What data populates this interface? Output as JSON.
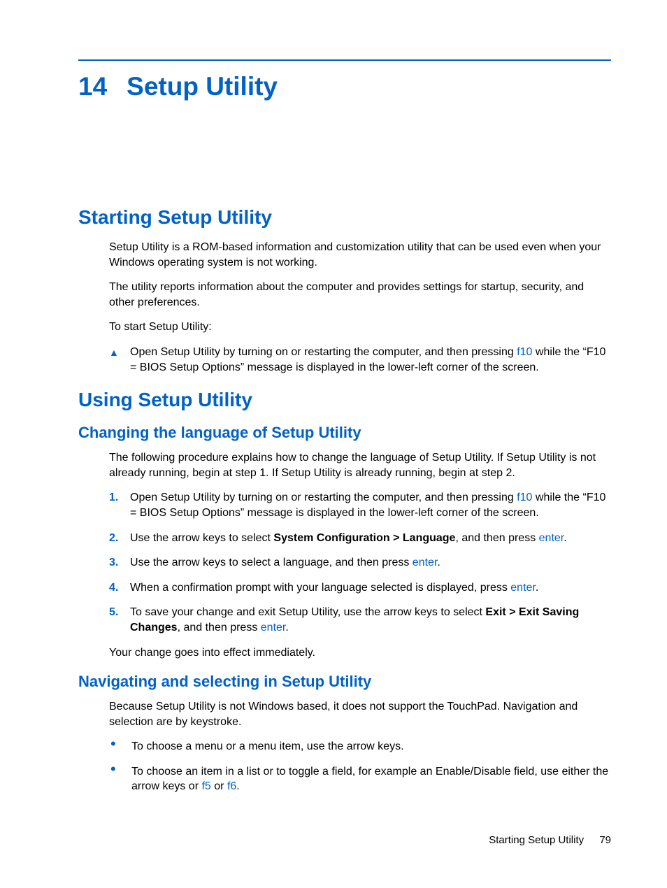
{
  "chapter": {
    "number": "14",
    "title": "Setup Utility"
  },
  "s1": {
    "title": "Starting Setup Utility",
    "p1": "Setup Utility is a ROM-based information and customization utility that can be used even when your Windows operating system is not working.",
    "p2": "The utility reports information about the computer and provides settings for startup, security, and other preferences.",
    "p3": "To start Setup Utility:",
    "step_a": "Open Setup Utility by turning on or restarting the computer, and then pressing ",
    "step_key": "f10",
    "step_b": " while the “F10 = BIOS Setup Options” message is displayed in the lower-left corner of the screen."
  },
  "s2": {
    "title": "Using Setup Utility",
    "sub1": {
      "title": "Changing the language of Setup Utility",
      "intro": "The following procedure explains how to change the language of Setup Utility. If Setup Utility is not already running, begin at step 1. If Setup Utility is already running, begin at step 2.",
      "n1a": "Open Setup Utility by turning on or restarting the computer, and then pressing ",
      "n1key": "f10",
      "n1b": " while the “F10 = BIOS Setup Options” message is displayed in the lower-left corner of the screen.",
      "n2a": "Use the arrow keys to select ",
      "n2bold": "System Configuration > Language",
      "n2b": ", and then press ",
      "n2key": "enter",
      "n2c": ".",
      "n3a": "Use the arrow keys to select a language, and then press ",
      "n3key": "enter",
      "n3b": ".",
      "n4a": "When a confirmation prompt with your language selected is displayed, press ",
      "n4key": "enter",
      "n4b": ".",
      "n5a": "To save your change and exit Setup Utility, use the arrow keys to select ",
      "n5bold": "Exit > Exit Saving Changes",
      "n5b": ", and then press ",
      "n5key": "enter",
      "n5c": ".",
      "outro": "Your change goes into effect immediately."
    },
    "sub2": {
      "title": "Navigating and selecting in Setup Utility",
      "intro": "Because Setup Utility is not Windows based, it does not support the TouchPad. Navigation and selection are by keystroke.",
      "b1": "To choose a menu or a menu item, use the arrow keys.",
      "b2a": "To choose an item in a list or to toggle a field, for example an Enable/Disable field, use either the arrow keys or ",
      "b2k1": "f5",
      "b2mid": " or ",
      "b2k2": "f6",
      "b2b": "."
    }
  },
  "footer": {
    "label": "Starting Setup Utility",
    "page": "79"
  },
  "markers": {
    "m1": "1.",
    "m2": "2.",
    "m3": "3.",
    "m4": "4.",
    "m5": "5."
  }
}
